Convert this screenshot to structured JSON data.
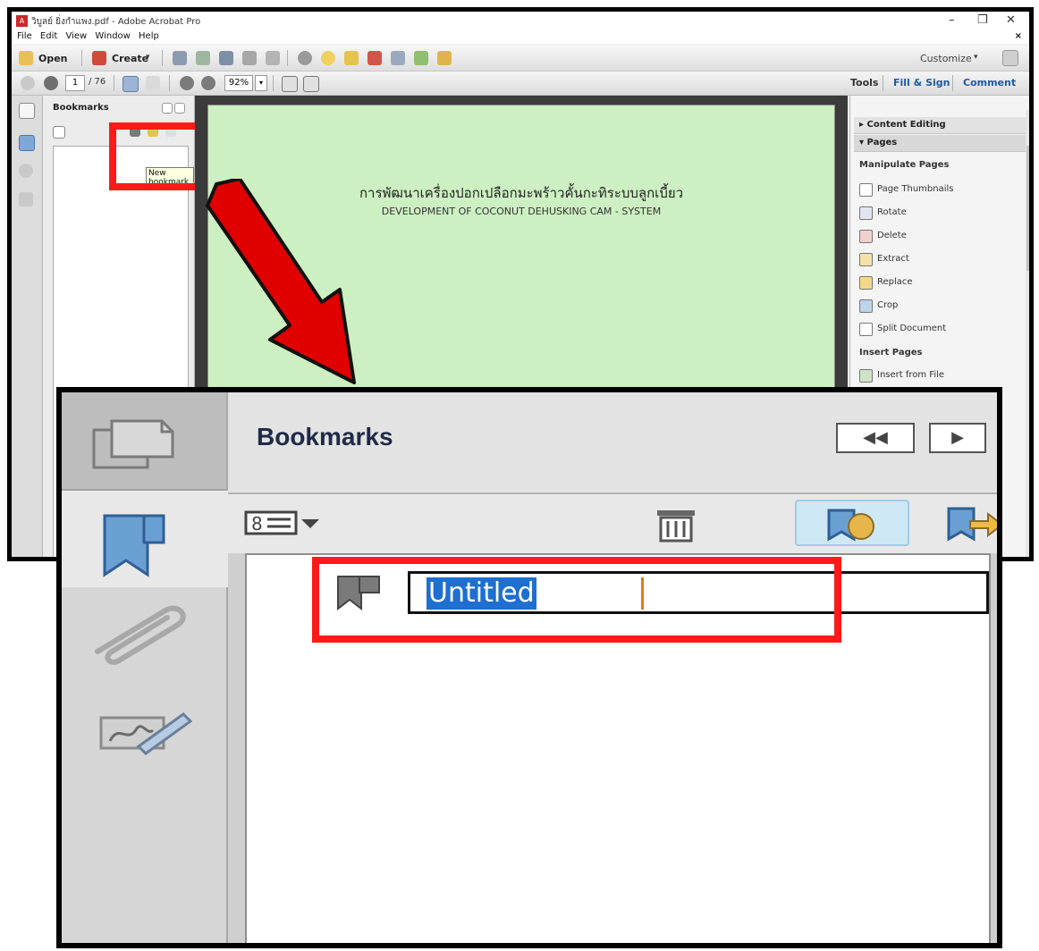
{
  "window": {
    "title": "วิบูลย์ ยิ่งกำแพง.pdf - Adobe Acrobat Pro",
    "controls": [
      "–",
      "❐",
      "✕"
    ]
  },
  "menu": [
    "File",
    "Edit",
    "View",
    "Window",
    "Help"
  ],
  "menu_close": "×",
  "toolbar": {
    "open_label": "Open",
    "create_label": "Create",
    "customize_label": "Customize"
  },
  "nav": {
    "page_current": "1",
    "page_total": "/ 76",
    "zoom_value": "92%",
    "tools_label": "Tools",
    "fill_sign_label": "Fill & Sign",
    "comment_label": "Comment"
  },
  "bookmarks_panel": {
    "title": "Bookmarks",
    "tooltip": "New bookmark"
  },
  "document": {
    "thai_title": "การพัฒนาเครื่องปอกเปลือกมะพร้าวคั้นกะทิระบบลูกเบี้ยว",
    "english_title": "DEVELOPMENT OF COCONUT DEHUSKING CAM - SYSTEM"
  },
  "right_panel": {
    "content_editing": "Content Editing",
    "pages": "Pages",
    "manipulate_heading": "Manipulate Pages",
    "items": [
      "Page Thumbnails",
      "Rotate",
      "Delete",
      "Extract",
      "Replace",
      "Crop",
      "Split Document"
    ],
    "insert_heading": "Insert Pages",
    "insert_item": "Insert from File"
  },
  "zoom_inset": {
    "title": "Bookmarks",
    "new_bookmark_text": "Untitled"
  },
  "colors": {
    "highlight_red": "#ff1a1a",
    "arrow_red": "#e00000",
    "selection_blue": "#1e6fd0",
    "page_green": "#cdf0c2"
  }
}
